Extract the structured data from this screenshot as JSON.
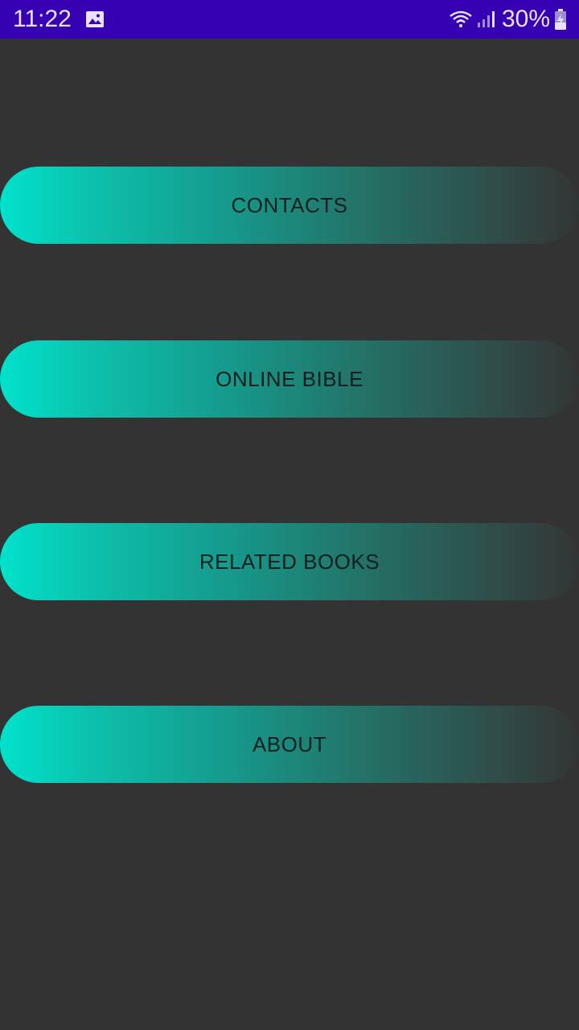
{
  "status_bar": {
    "time": "11:22",
    "battery_percent": "30%",
    "background_color": "#3700b3",
    "icons": [
      "gallery-icon",
      "wifi-icon",
      "signal-icon",
      "battery-charging-icon"
    ]
  },
  "menu": {
    "contacts_label": "CONTACTS",
    "online_bible_label": "ONLINE BIBLE",
    "related_books_label": "RELATED BOOKS",
    "about_label": "ABOUT"
  },
  "colors": {
    "background": "#333333",
    "button_gradient_start": "#00e2cc",
    "button_gradient_end": "#333535"
  }
}
